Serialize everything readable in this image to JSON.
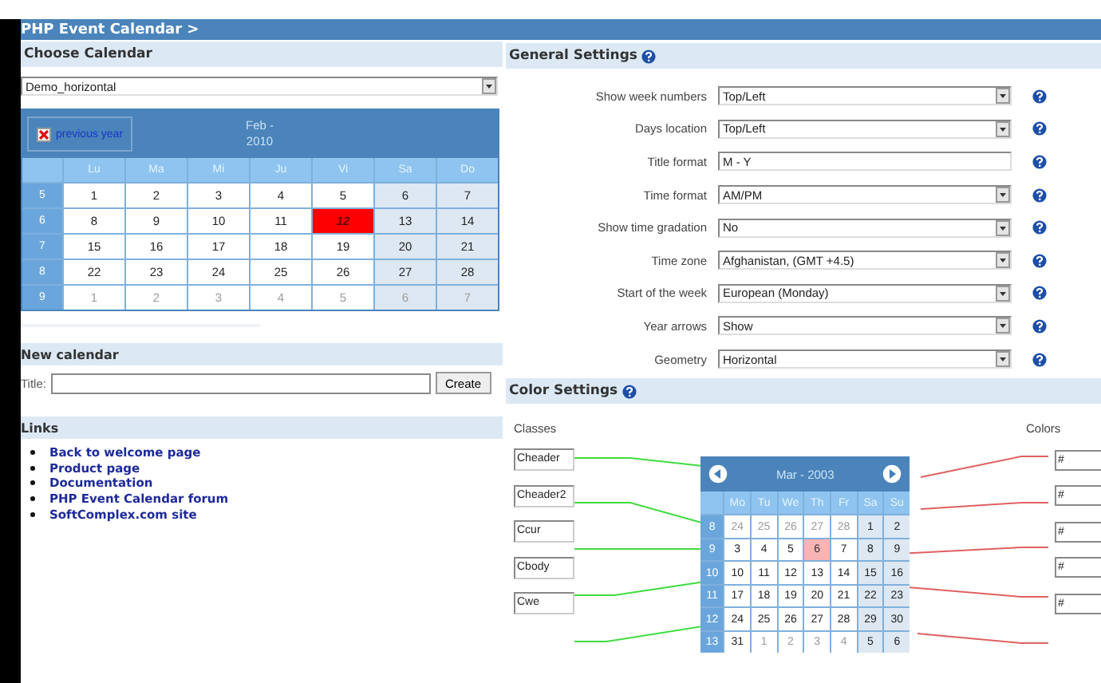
{
  "breadcrumb": "PHP Event Calendar >",
  "choose_calendar": {
    "title": "Choose Calendar",
    "value": "Demo_horizontal"
  },
  "calendar": {
    "prev_button": "previous year",
    "title_month": "Feb -",
    "title_year": "2010",
    "weekdays": [
      "Lu",
      "Ma",
      "Mi",
      "Ju",
      "Vi",
      "Sa",
      "Do"
    ],
    "weeks": [
      {
        "number": "5",
        "days": [
          {
            "text": "1",
            "kind": "day"
          },
          {
            "text": "2",
            "kind": "day"
          },
          {
            "text": "3",
            "kind": "day"
          },
          {
            "text": "4",
            "kind": "day"
          },
          {
            "text": "5",
            "kind": "day"
          },
          {
            "text": "6",
            "kind": "weekend"
          },
          {
            "text": "7",
            "kind": "weekend"
          }
        ]
      },
      {
        "number": "6",
        "days": [
          {
            "text": "8",
            "kind": "day"
          },
          {
            "text": "9",
            "kind": "day"
          },
          {
            "text": "10",
            "kind": "day"
          },
          {
            "text": "11",
            "kind": "day"
          },
          {
            "text": "12",
            "kind": "today"
          },
          {
            "text": "13",
            "kind": "weekend"
          },
          {
            "text": "14",
            "kind": "weekend"
          }
        ]
      },
      {
        "number": "7",
        "days": [
          {
            "text": "15",
            "kind": "day"
          },
          {
            "text": "16",
            "kind": "day"
          },
          {
            "text": "17",
            "kind": "day"
          },
          {
            "text": "18",
            "kind": "day"
          },
          {
            "text": "19",
            "kind": "day"
          },
          {
            "text": "20",
            "kind": "weekend"
          },
          {
            "text": "21",
            "kind": "weekend"
          }
        ]
      },
      {
        "number": "8",
        "days": [
          {
            "text": "22",
            "kind": "day"
          },
          {
            "text": "23",
            "kind": "day"
          },
          {
            "text": "24",
            "kind": "day"
          },
          {
            "text": "25",
            "kind": "day"
          },
          {
            "text": "26",
            "kind": "day"
          },
          {
            "text": "27",
            "kind": "weekend"
          },
          {
            "text": "28",
            "kind": "weekend"
          }
        ]
      },
      {
        "number": "9",
        "days": [
          {
            "text": "1",
            "kind": "other"
          },
          {
            "text": "2",
            "kind": "other"
          },
          {
            "text": "3",
            "kind": "other"
          },
          {
            "text": "4",
            "kind": "other"
          },
          {
            "text": "5",
            "kind": "other"
          },
          {
            "text": "6",
            "kind": "other_weekend"
          },
          {
            "text": "7",
            "kind": "other_weekend"
          }
        ]
      }
    ]
  },
  "new_calendar": {
    "title": "New calendar",
    "field_label": "Title:",
    "button": "Create"
  },
  "links": {
    "title": "Links",
    "items": [
      "Back to welcome page",
      "Product page",
      "Documentation",
      "PHP Event Calendar forum",
      "SoftComplex.com site"
    ]
  },
  "general_settings": {
    "title": "General Settings",
    "rows": [
      {
        "label": "Show week numbers",
        "value": "Top/Left",
        "kind": "select"
      },
      {
        "label": "Days location",
        "value": "Top/Left",
        "kind": "select"
      },
      {
        "label": "Title format",
        "value": "M - Y",
        "kind": "text"
      },
      {
        "label": "Time format",
        "value": "AM/PM",
        "kind": "select"
      },
      {
        "label": "Show time gradation",
        "value": "No",
        "kind": "select"
      },
      {
        "label": "Time zone",
        "value": "Afghanistan, (GMT +4.5)",
        "kind": "select"
      },
      {
        "label": "Start of the week",
        "value": "European (Monday)",
        "kind": "select"
      },
      {
        "label": "Year arrows",
        "value": "Show",
        "kind": "select"
      },
      {
        "label": "Geometry",
        "value": "Horizontal",
        "kind": "select"
      }
    ]
  },
  "color_settings": {
    "title": "Color Settings",
    "classes_label": "Classes",
    "colors_label": "Colors",
    "classes": [
      "Cheader",
      "Cheader2",
      "Ccur",
      "Cbody",
      "Cwe"
    ],
    "colors": [
      "#",
      "#",
      "#",
      "#",
      "#"
    ],
    "preview": {
      "title": "Mar - 2003",
      "weekdays": [
        "Mo",
        "Tu",
        "We",
        "Th",
        "Fr",
        "Sa",
        "Su"
      ],
      "weeks": [
        {
          "number": "8",
          "days": [
            {
              "text": "24",
              "kind": "other"
            },
            {
              "text": "25",
              "kind": "other"
            },
            {
              "text": "26",
              "kind": "other"
            },
            {
              "text": "27",
              "kind": "other"
            },
            {
              "text": "28",
              "kind": "other"
            },
            {
              "text": "1",
              "kind": "weekend"
            },
            {
              "text": "2",
              "kind": "weekend"
            }
          ]
        },
        {
          "number": "9",
          "days": [
            {
              "text": "3",
              "kind": "day"
            },
            {
              "text": "4",
              "kind": "day"
            },
            {
              "text": "5",
              "kind": "day"
            },
            {
              "text": "6",
              "kind": "today"
            },
            {
              "text": "7",
              "kind": "day"
            },
            {
              "text": "8",
              "kind": "weekend"
            },
            {
              "text": "9",
              "kind": "weekend"
            }
          ]
        },
        {
          "number": "10",
          "days": [
            {
              "text": "10",
              "kind": "day"
            },
            {
              "text": "11",
              "kind": "day"
            },
            {
              "text": "12",
              "kind": "day"
            },
            {
              "text": "13",
              "kind": "day"
            },
            {
              "text": "14",
              "kind": "day"
            },
            {
              "text": "15",
              "kind": "weekend"
            },
            {
              "text": "16",
              "kind": "weekend"
            }
          ]
        },
        {
          "number": "11",
          "days": [
            {
              "text": "17",
              "kind": "day"
            },
            {
              "text": "18",
              "kind": "day"
            },
            {
              "text": "19",
              "kind": "day"
            },
            {
              "text": "20",
              "kind": "day"
            },
            {
              "text": "21",
              "kind": "day"
            },
            {
              "text": "22",
              "kind": "weekend"
            },
            {
              "text": "23",
              "kind": "weekend"
            }
          ]
        },
        {
          "number": "12",
          "days": [
            {
              "text": "24",
              "kind": "day"
            },
            {
              "text": "25",
              "kind": "day"
            },
            {
              "text": "26",
              "kind": "day"
            },
            {
              "text": "27",
              "kind": "day"
            },
            {
              "text": "28",
              "kind": "day"
            },
            {
              "text": "29",
              "kind": "weekend"
            },
            {
              "text": "30",
              "kind": "weekend"
            }
          ]
        },
        {
          "number": "13",
          "days": [
            {
              "text": "31",
              "kind": "day"
            },
            {
              "text": "1",
              "kind": "other"
            },
            {
              "text": "2",
              "kind": "other"
            },
            {
              "text": "3",
              "kind": "other"
            },
            {
              "text": "4",
              "kind": "other"
            },
            {
              "text": "5",
              "kind": "weekend"
            },
            {
              "text": "6",
              "kind": "weekend"
            }
          ]
        }
      ]
    }
  }
}
